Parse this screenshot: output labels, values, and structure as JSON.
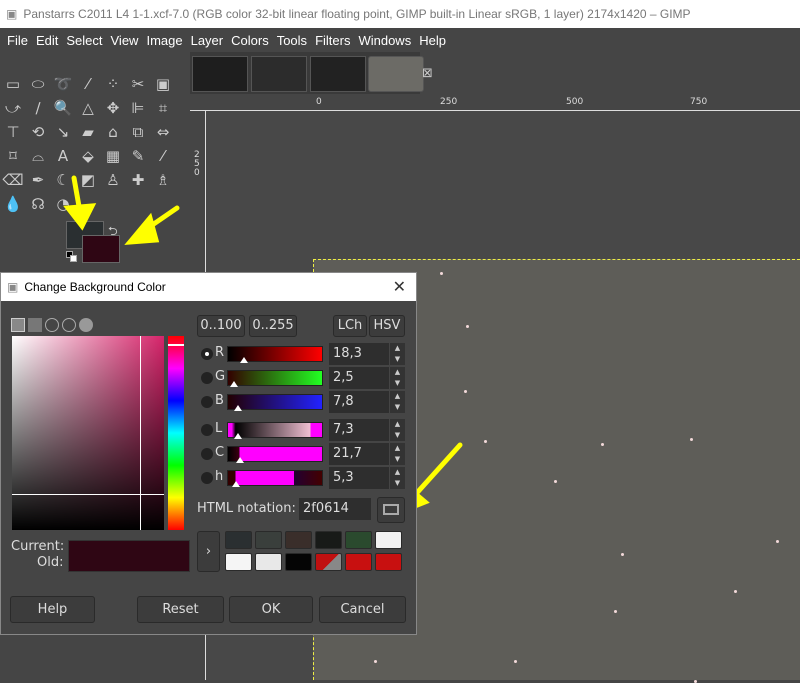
{
  "window": {
    "title": "Panstarrs C2011 L4 1-1.xcf-7.0 (RGB color 32-bit linear floating point, GIMP built-in Linear sRGB, 1 layer) 2174x1420 – GIMP"
  },
  "menu": [
    "File",
    "Edit",
    "Select",
    "View",
    "Image",
    "Layer",
    "Colors",
    "Tools",
    "Filters",
    "Windows",
    "Help"
  ],
  "colors": {
    "foreground": "#2a2f31",
    "background": "#2f0614",
    "accent_arrow": "#ffff00"
  },
  "ruler": {
    "top_labels": [
      "0",
      "250",
      "500",
      "750"
    ],
    "left_label": "250"
  },
  "dialog": {
    "title": "Change Background Color",
    "range_buttons": [
      "0..100",
      "0..255"
    ],
    "model_buttons": [
      "LCh",
      "HSV"
    ],
    "channels": [
      {
        "label": "R",
        "value": "18,3",
        "selected": true
      },
      {
        "label": "G",
        "value": "2,5",
        "selected": false
      },
      {
        "label": "B",
        "value": "7,8",
        "selected": false
      },
      {
        "label": "L",
        "value": "7,3",
        "selected": false
      },
      {
        "label": "C",
        "value": "21,7",
        "selected": false
      },
      {
        "label": "h",
        "value": "5,3",
        "selected": false
      }
    ],
    "html_label": "HTML notation:",
    "html_value": "2f0614",
    "current_label": "Current:",
    "old_label": "Old:",
    "history": [
      "#2a2f31",
      "#3a3f3c",
      "#3a2e2a",
      "#181a18",
      "#2a4a2e",
      "#f2f2f2",
      "#f5f5f5",
      "#e8e8e8",
      "#050505",
      "#c01010",
      "#c81010",
      "#c81010"
    ],
    "buttons": {
      "help": "Help",
      "reset": "Reset",
      "ok": "OK",
      "cancel": "Cancel"
    }
  }
}
